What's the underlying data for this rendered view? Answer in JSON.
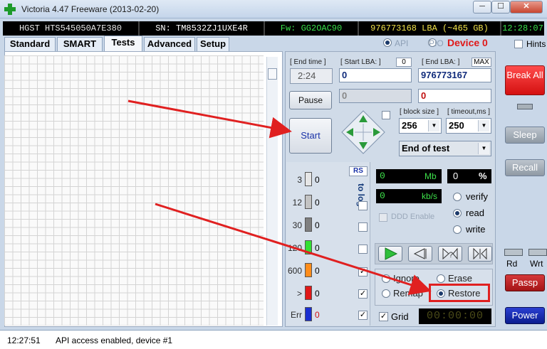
{
  "window": {
    "title": "Victoria 4.47  Freeware (2013-02-20)",
    "minimize": "─",
    "maximize": "☐",
    "close": "✕"
  },
  "drive": {
    "model": "HGST HTS545050A7E380",
    "serial": "SN: TM8532ZJ1UXE4R",
    "firmware": "Fw: GG2OAC90",
    "lba": "976773168 LBA (~465 GB)",
    "clock": "12:28:07"
  },
  "tabs": [
    "Standard",
    "SMART",
    "Tests",
    "Advanced",
    "Setup"
  ],
  "active_tab": "Tests",
  "mode": {
    "api": "API",
    "pio": "PIO",
    "device": "Device 0",
    "hints": "Hints"
  },
  "range": {
    "end_time_label": "[ End time ]",
    "end_time": "2:24",
    "start_lba_label": "[ Start LBA: ]",
    "start_lba_badge": "0",
    "start_lba": "0",
    "end_lba_label": "[ End LBA: ]",
    "max_label": "MAX",
    "end_lba": "976773167",
    "start_lba_2": "0",
    "end_lba_2": "0"
  },
  "buttons": {
    "pause": "Pause",
    "start": "Start"
  },
  "block": {
    "block_size_label": "[ block size ]",
    "block_size": "256",
    "timeout_label": "[ timeout,ms ]",
    "timeout": "250",
    "end_action": "End of test"
  },
  "stats": {
    "rs": "RS",
    "to_log": "to log:",
    "rows": [
      {
        "label": "3",
        "count": "0",
        "color": "#e6e6e6",
        "checked": ""
      },
      {
        "label": "12",
        "count": "0",
        "color": "#c3c3c3",
        "checked": ""
      },
      {
        "label": "30",
        "count": "0",
        "color": "#7f7f7f",
        "checked": ""
      },
      {
        "label": "120",
        "count": "0",
        "color": "#33e033",
        "checked": ""
      },
      {
        "label": "600",
        "count": "0",
        "color": "#ff8c1a",
        "checked": "✓"
      },
      {
        "label": ">",
        "count": "0",
        "color": "#e01818",
        "checked": "✓"
      },
      {
        "label": "Err",
        "count": "0",
        "color": "#1a2fd1",
        "checked": "✓"
      }
    ]
  },
  "rates": {
    "mb_value": "0",
    "mb_unit": "Mb",
    "percent_value": "0",
    "percent_unit": "%",
    "kbs_value": "0",
    "kbs_unit": "kb/s",
    "ddd_enable": "DDD Enable"
  },
  "verify_modes": {
    "verify": "verify",
    "read": "read",
    "write": "write",
    "selected": "read"
  },
  "actions": {
    "ignore": "Ignore",
    "erase": "Erase",
    "remap": "Remap",
    "restore": "Restore",
    "selected": "Restore"
  },
  "grid_toggle": {
    "label": "Grid",
    "checked": "✓"
  },
  "timer": "00:00:00",
  "side": {
    "break_all": "Break All",
    "sleep": "Sleep",
    "recall": "Recall",
    "rd": "Rd",
    "wrt": "Wrt",
    "passp": "Passp",
    "power": "Power"
  },
  "log": {
    "time": "12:27:51",
    "message": "API access enabled, device #1"
  },
  "colors": {
    "annotation_arrow": "#e02020",
    "restore_highlight": "#e02020"
  }
}
